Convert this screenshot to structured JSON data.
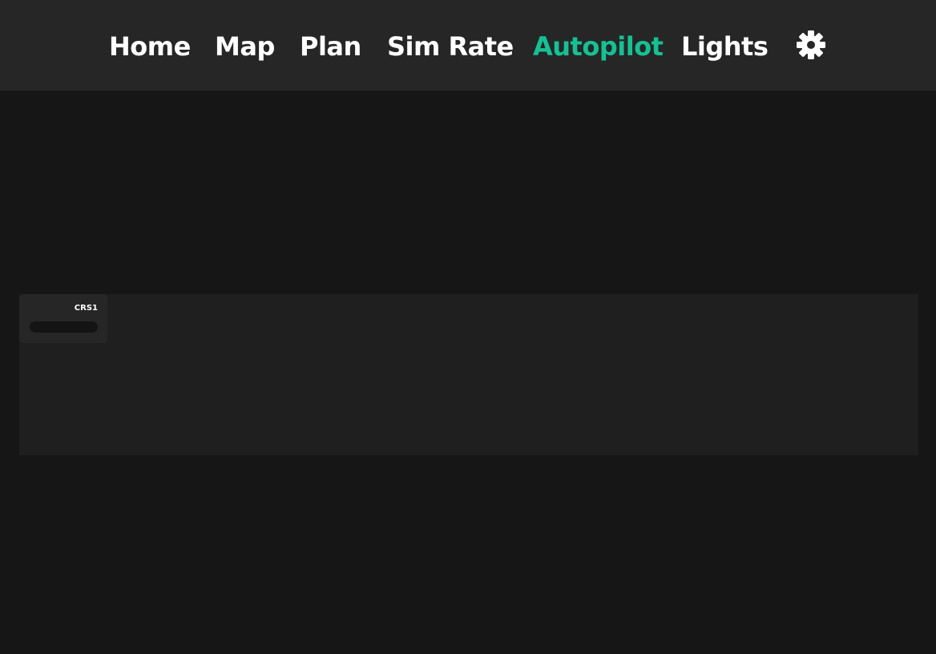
{
  "nav": {
    "items": [
      {
        "label": "Home",
        "active": false
      },
      {
        "label": "Map",
        "active": false
      },
      {
        "label": "Plan",
        "active": false
      },
      {
        "label": "Sim Rate",
        "active": false
      },
      {
        "label": "Autopilot",
        "active": true
      },
      {
        "label": "Lights",
        "active": false
      }
    ],
    "settings_icon": "gear-icon"
  },
  "autopilot": {
    "crs1": {
      "label": "CRS1",
      "value": ""
    }
  },
  "colors": {
    "background": "#161616",
    "nav_background": "#262626",
    "panel_background": "#1f1f1f",
    "accent": "#16c095",
    "text": "#ffffff"
  }
}
